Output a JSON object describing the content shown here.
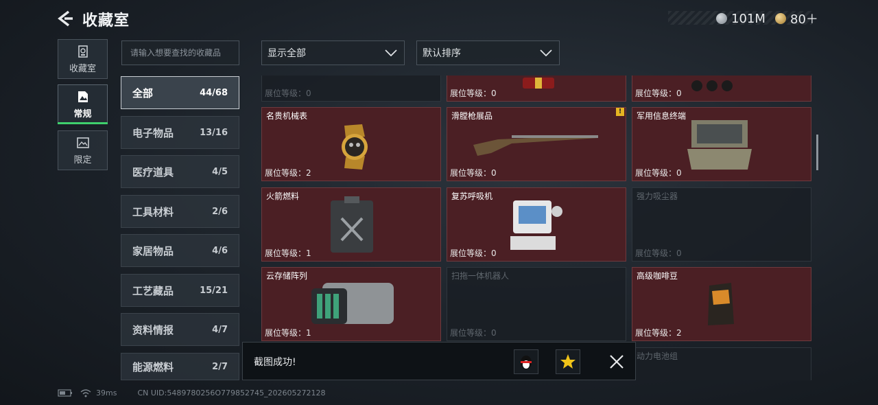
{
  "header": {
    "title": "收藏室",
    "currency_silver": "101M",
    "currency_gold": "80＋"
  },
  "nav": [
    {
      "label": "收藏室",
      "icon": "cabinet-icon"
    },
    {
      "label": "常规",
      "icon": "document-icon",
      "active": true
    },
    {
      "label": "限定",
      "icon": "picture-icon"
    }
  ],
  "search": {
    "placeholder": "请输入想要查找的收藏品"
  },
  "filters": {
    "display": "显示全部",
    "sort": "默认排序"
  },
  "categories": [
    {
      "label": "全部",
      "count": "44/68",
      "active": true
    },
    {
      "label": "电子物品",
      "count": "13/16"
    },
    {
      "label": "医疗道具",
      "count": "4/5"
    },
    {
      "label": "工具材料",
      "count": "2/6"
    },
    {
      "label": "家居物品",
      "count": "4/6"
    },
    {
      "label": "工艺藏品",
      "count": "15/21"
    },
    {
      "label": "资料情报",
      "count": "4/7"
    },
    {
      "label": "能源燃料",
      "count": "2/7"
    }
  ],
  "items": [
    {
      "name": "",
      "level": "展位等级：0",
      "owned": false
    },
    {
      "name": "",
      "level": "展位等级：0",
      "owned": true
    },
    {
      "name": "",
      "level": "展位等级：0",
      "owned": true
    },
    {
      "name": "名贵机械表",
      "level": "展位等级：2",
      "owned": true
    },
    {
      "name": "滑膛枪展品",
      "level": "展位等级：0",
      "owned": true,
      "warning": "!"
    },
    {
      "name": "军用信息终端",
      "level": "展位等级：0",
      "owned": true
    },
    {
      "name": "火箭燃料",
      "level": "展位等级：1",
      "owned": true
    },
    {
      "name": "复苏呼吸机",
      "level": "展位等级：0",
      "owned": true
    },
    {
      "name": "强力吸尘器",
      "level": "展位等级：0",
      "owned": false
    },
    {
      "name": "云存储阵列",
      "level": "展位等级：1",
      "owned": true
    },
    {
      "name": "扫拖一体机器人",
      "level": "展位等级：0",
      "owned": false
    },
    {
      "name": "高级咖啡豆",
      "level": "展位等级：2",
      "owned": true
    },
    {
      "name": "",
      "level": "",
      "owned": false
    },
    {
      "name": "",
      "level": "",
      "owned": false
    },
    {
      "name": "动力电池组",
      "level": "",
      "owned": false
    }
  ],
  "toast": {
    "message": "截图成功!"
  },
  "status": {
    "ping": "39ms",
    "uid": "CN UID:5489780256O779852745_202605272128"
  },
  "colors": {
    "owned_card": "#4b1f24",
    "active_green": "#3fd06d",
    "warning": "#e6b522"
  }
}
